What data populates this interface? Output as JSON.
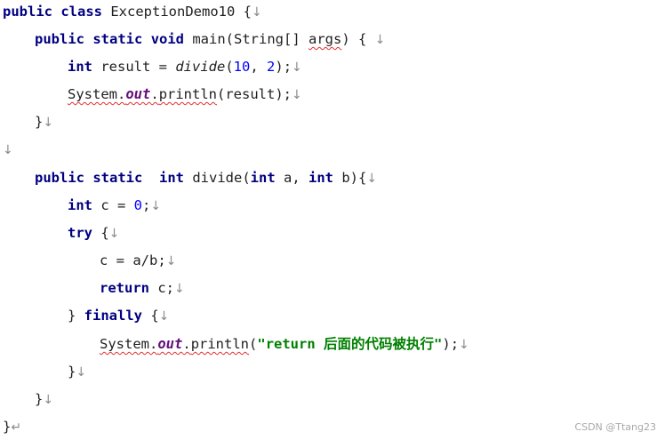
{
  "code": {
    "line_mark": "↓",
    "end_mark": "↵",
    "k_public": "public",
    "k_class": "class",
    "class_name": " ExceptionDemo10 {",
    "k_static": "static",
    "k_void": "void",
    "main_sig_a": " main(String[] ",
    "main_args": "args",
    "main_sig_b": ") {",
    "k_int": "int",
    "result_a": " result = ",
    "divide_call": "divide",
    "result_b": "(",
    "num_10": "10",
    "comma_sp": ", ",
    "num_2": "2",
    "result_c": ");",
    "system": "System",
    "dot": ".",
    "out": "out",
    "println": "println",
    "println_result": "(result);",
    "close_brace": "}",
    "divide_decl": " divide(",
    "param_a": " a, ",
    "param_b": " b){",
    "c_assign": " c = ",
    "num_0": "0",
    "semicolon": ";",
    "k_try": "try",
    "open_brace": " {",
    "c_div": "c = a/b;",
    "k_return": "return",
    "return_c": " c;",
    "close_brace_sp": "} ",
    "k_finally": "finally",
    "println_open": "(",
    "string_literal": "\"return 后面的代码被执行\"",
    "println_close": ");"
  },
  "watermark": "CSDN @Ttang23"
}
